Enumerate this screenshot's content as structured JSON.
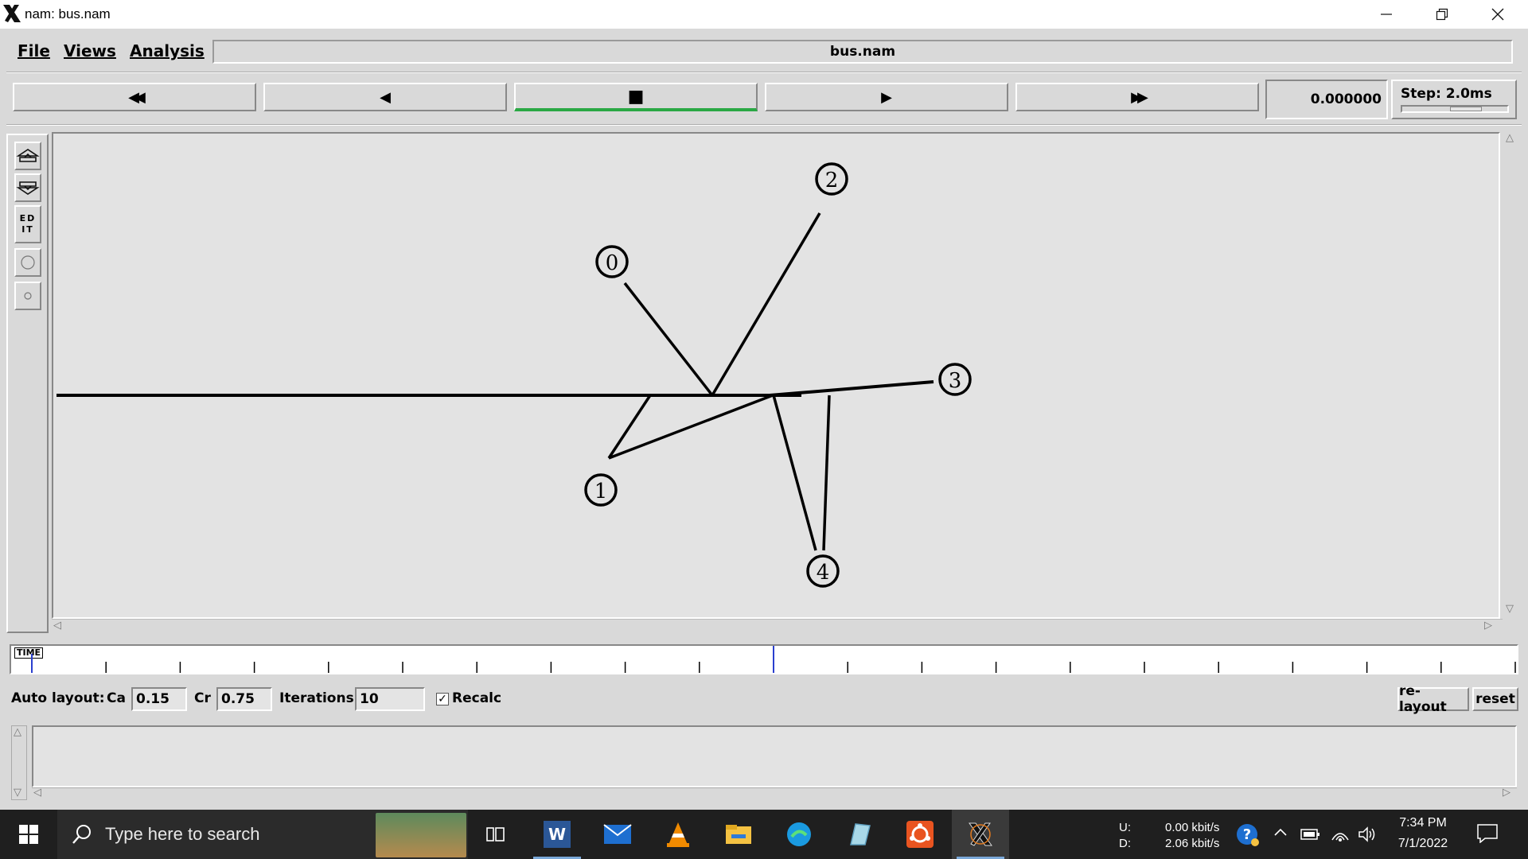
{
  "window": {
    "title": "nam: bus.nam",
    "app_icon": "x-logo-icon",
    "controls": [
      "minimize-icon",
      "restore-icon",
      "close-icon"
    ]
  },
  "menu": {
    "file": "File",
    "views": "Views",
    "analysis": "Analysis",
    "filename": "bus.nam"
  },
  "playback": {
    "buttons": [
      {
        "name": "fast-rewind",
        "icon": "fast-rewind-icon",
        "glyph": "◀◀"
      },
      {
        "name": "rewind",
        "icon": "play-backward-icon",
        "glyph": "◀"
      },
      {
        "name": "stop",
        "icon": "stop-icon",
        "glyph": "■"
      },
      {
        "name": "play",
        "icon": "play-icon",
        "glyph": "▶"
      },
      {
        "name": "fast-forward",
        "icon": "fast-forward-icon",
        "glyph": "▶▶"
      }
    ],
    "active_button": "stop",
    "active_color": "#2aa844",
    "time": "0.000000",
    "step_label": "Step: 2.0ms"
  },
  "toolbar": {
    "tools": [
      "zoom-in-icon",
      "zoom-out-icon",
      "edit-tool",
      "circle-large-icon",
      "circle-small-icon"
    ],
    "edit_label": "ED IT"
  },
  "topology": {
    "nodes": [
      {
        "id": "0",
        "label": "0"
      },
      {
        "id": "1",
        "label": "1"
      },
      {
        "id": "2",
        "label": "2"
      },
      {
        "id": "3",
        "label": "3"
      },
      {
        "id": "4",
        "label": "4"
      }
    ]
  },
  "timeline": {
    "label": "TIME",
    "tick_count": 20,
    "current_marker_fraction": 0.5
  },
  "auto_layout": {
    "label": "Auto layout:",
    "ca_label": "Ca",
    "ca_value": "0.15",
    "cr_label": "Cr",
    "cr_value": "0.75",
    "iterations_label": "Iterations",
    "iterations_value": "10",
    "recalc_label": "Recalc",
    "recalc_checked": true,
    "relayout_label": "re-layout",
    "reset_label": "reset"
  },
  "taskbar": {
    "search_placeholder": "Type here to search",
    "apps": [
      "task-view-icon",
      "word-icon",
      "mail-icon",
      "vlc-icon",
      "file-explorer-icon",
      "edge-icon",
      "app-icon",
      "ubuntu-icon",
      "xming-icon"
    ],
    "net_upload_label": "U:",
    "net_download_label": "D:",
    "net_upload": "0.00 kbit/s",
    "net_download": "2.06 kbit/s",
    "time": "7:34 PM",
    "date": "7/1/2022"
  }
}
